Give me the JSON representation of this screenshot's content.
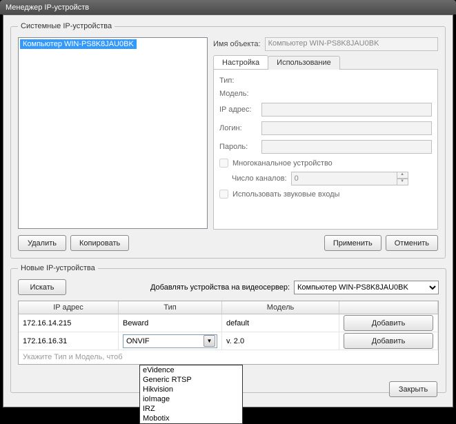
{
  "window": {
    "title": "Менеджер IP-устройств"
  },
  "system_group": {
    "legend": "Системные IP-устройства",
    "tree_item": "Компьютер WIN-PS8K8JAU0BK",
    "object_label": "Имя объекта:",
    "object_value": "Компьютер WIN-PS8K8JAU0BK",
    "tabs": {
      "settings": "Настройка",
      "usage": "Использование"
    },
    "fields": {
      "type": "Тип:",
      "model": "Модель:",
      "ip": "IP адрес:",
      "login": "Логин:",
      "password": "Пароль:",
      "multichannel": "Многоканальное устройство",
      "channels_label": "Число каналов:",
      "channels_value": "0",
      "use_audio": "Использовать звуковые входы"
    },
    "buttons": {
      "delete": "Удалить",
      "copy": "Копировать",
      "apply": "Применить",
      "cancel": "Отменить"
    }
  },
  "new_group": {
    "legend": "Новые IP-устройства",
    "search": "Искать",
    "add_to_label": "Добавлять устройства на видеосервер:",
    "server_selected": "Компьютер WIN-PS8K8JAU0BK",
    "columns": {
      "ip": "IP адрес",
      "type": "Тип",
      "model": "Модель"
    },
    "rows": [
      {
        "ip": "172.16.14.215",
        "type": "Beward",
        "model": "default",
        "add": "Добавить"
      },
      {
        "ip": "172.16.16.31",
        "type": "ONVIF",
        "model": "v. 2.0",
        "add": "Добавить"
      }
    ],
    "hint": "Укажите Тип и Модель, чтоб",
    "dropdown": [
      "eVidence",
      "Generic RTSP",
      "Hikvision",
      "ioImage",
      "IRZ",
      "Mobotix"
    ]
  },
  "close": "Закрыть"
}
